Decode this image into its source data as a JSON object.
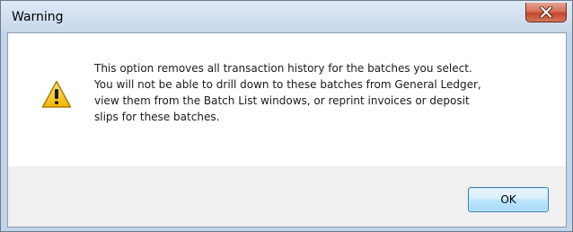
{
  "window": {
    "title": "Warning",
    "close_icon": "close-icon"
  },
  "message": {
    "icon": "warning-icon",
    "lines": [
      "This option removes all transaction history for the batches you select.",
      "You will not be able to drill down to these batches from General Ledger,",
      "view them from the Batch List windows, or reprint invoices or deposit",
      "slips for these batches."
    ]
  },
  "buttons": {
    "ok_label": "OK"
  },
  "colors": {
    "warning_fill": "#f5c400",
    "close_button": "#c7442a"
  }
}
